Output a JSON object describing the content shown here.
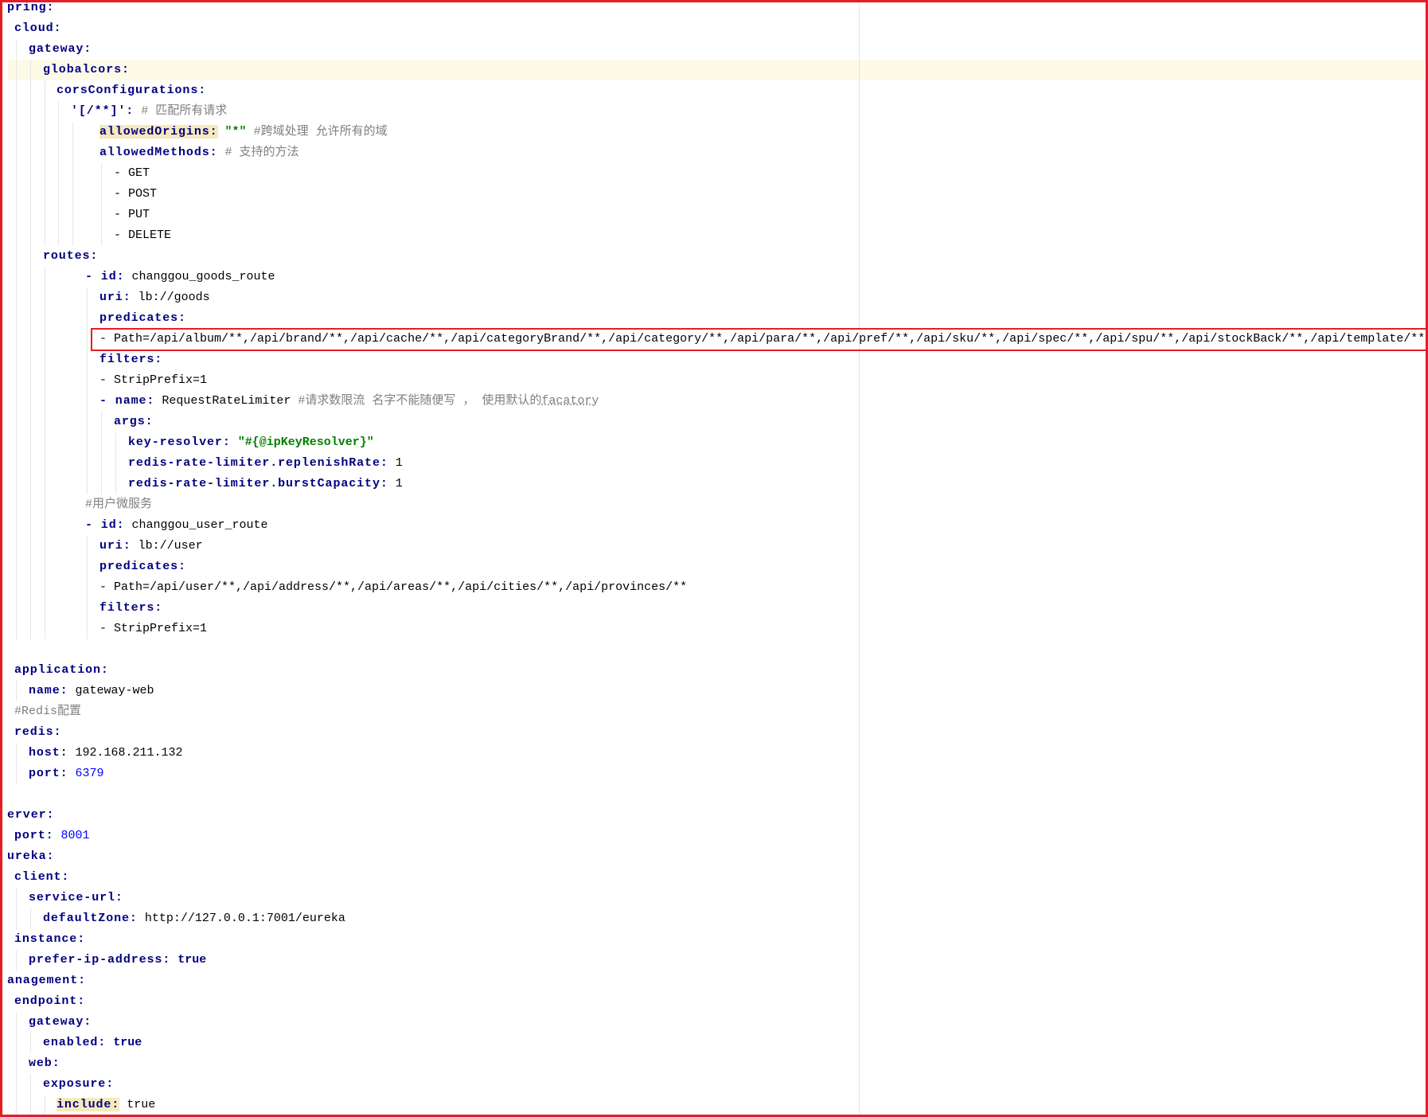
{
  "syntax_colors": {
    "key": "#000080",
    "string": "#008000",
    "number": "#0000ff",
    "comment": "#808080",
    "annotation_border": "#e31e24"
  },
  "editor": {
    "lines": [
      {
        "key": "pring:"
      },
      {
        "key": "cloud:"
      },
      {
        "key": "gateway:"
      },
      {
        "key": "globalcors:"
      },
      {
        "key": "corsConfigurations:"
      },
      {
        "key": "'[/**]':",
        "comment": "# 匹配所有请求"
      },
      {
        "key": "allowedOrigins:",
        "string": "\"*\"",
        "comment": "#跨域处理 允许所有的域"
      },
      {
        "key": "allowedMethods:",
        "comment": "# 支持的方法"
      },
      {
        "value": "- GET"
      },
      {
        "value": "- POST"
      },
      {
        "value": "- PUT"
      },
      {
        "value": "- DELETE"
      },
      {
        "key": "routes:"
      },
      {
        "key": "- id:",
        "value": "changgou_goods_route"
      },
      {
        "key": "uri:",
        "value": "lb://goods"
      },
      {
        "key": "predicates:"
      },
      {
        "value": "- Path=/api/album/**,/api/brand/**,/api/cache/**,/api/categoryBrand/**,/api/category/**,/api/para/**,/api/pref/**,/api/sku/**,/api/spec/**,/api/spu/**,/api/stockBack/**,/api/template/**"
      },
      {
        "key": "filters:"
      },
      {
        "value": "- StripPrefix=1"
      },
      {
        "key": "- name:",
        "value": "RequestRateLimiter",
        "comment": "#请求数限流 名字不能随便写 ， 使用默认的",
        "comment_underlined": "facatory"
      },
      {
        "key": "args:"
      },
      {
        "key": "key-resolver:",
        "string": "\"#{@ipKeyResolver}\""
      },
      {
        "key": "redis-rate-limiter.replenishRate:",
        "value": "1"
      },
      {
        "key": "redis-rate-limiter.burstCapacity:",
        "value": "1"
      },
      {
        "comment": "#用户微服务"
      },
      {
        "key": "- id:",
        "value": "changgou_user_route"
      },
      {
        "key": "uri:",
        "value": "lb://user"
      },
      {
        "key": "predicates:"
      },
      {
        "value": "- Path=/api/user/**,/api/address/**,/api/areas/**,/api/cities/**,/api/provinces/**"
      },
      {
        "key": "filters:"
      },
      {
        "value": "- StripPrefix=1"
      },
      {},
      {
        "key": "application:"
      },
      {
        "key": "name:",
        "value": "gateway-web"
      },
      {
        "comment": "#Redis配置"
      },
      {
        "key": "redis:"
      },
      {
        "key": "host:",
        "value": "192.168.211.132"
      },
      {
        "key": "port:",
        "number": "6379"
      },
      {},
      {
        "key": "erver:"
      },
      {
        "key": "port:",
        "number": "8001"
      },
      {
        "key": "ureka:"
      },
      {
        "key": "client:"
      },
      {
        "key": "service-url:"
      },
      {
        "key": "defaultZone:",
        "value": "http://127.0.0.1:7001/eureka"
      },
      {
        "key": "instance:"
      },
      {
        "key": "prefer-ip-address:",
        "keyword": "true"
      },
      {
        "key": "anagement:"
      },
      {
        "key": "endpoint:"
      },
      {
        "key": "gateway:"
      },
      {
        "key": "enabled:",
        "keyword": "true"
      },
      {
        "key": "web:"
      },
      {
        "key": "exposure:"
      },
      {
        "key": "include:",
        "value": "true"
      }
    ]
  }
}
